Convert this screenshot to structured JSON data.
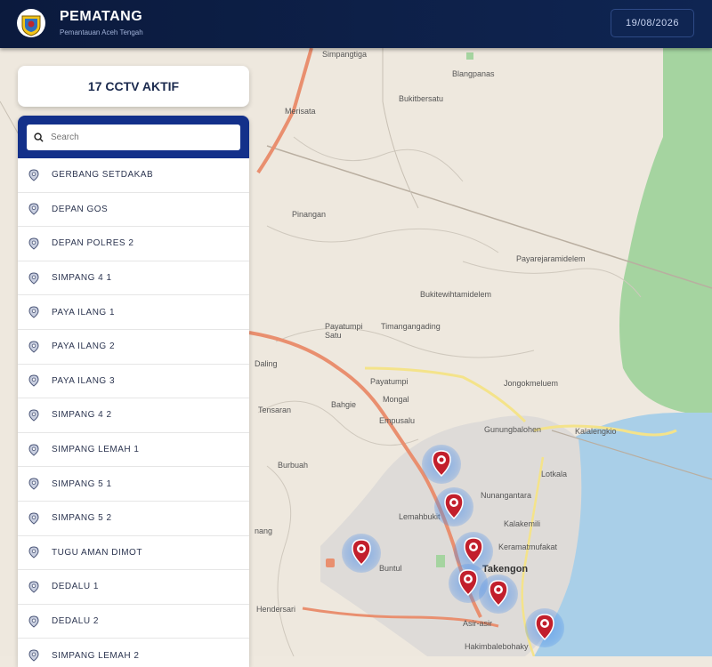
{
  "header": {
    "title": "PEMATANG",
    "subtitle": "Pemantauan Aceh Tengah",
    "date": "19/08/2026"
  },
  "summary": {
    "label": "17 CCTV AKTIF"
  },
  "search": {
    "placeholder": "Search"
  },
  "cctv_list": [
    "GERBANG SETDAKAB",
    "DEPAN GOS",
    "DEPAN POLRES 2",
    "SIMPANG 4 1",
    "PAYA ILANG 1",
    "PAYA ILANG 2",
    "PAYA ILANG 3",
    "SIMPANG 4 2",
    "SIMPANG LEMAH 1",
    "SIMPANG 5 1",
    "SIMPANG 5 2",
    "TUGU AMAN DIMOT",
    "DEDALU 1",
    "DEDALU 2",
    "SIMPANG LEMAH 2"
  ],
  "map_labels": {
    "simpangtiga": "Simpangtiga",
    "blangpanas": "Blangpanas",
    "bukitbersatu": "Bukitbersatu",
    "merisata": "Merisata",
    "pinangan": "Pinangan",
    "payarejarami": "Payarejaramidelem",
    "bukitewihtami": "Bukitewihtamidelem",
    "payatumpi_satu": "Payatumpi Satu",
    "timangangading": "Timangangading",
    "daling": "Daling",
    "payatumpi": "Payatumpi",
    "mongal": "Mongal",
    "bahgie": "Bahgie",
    "tensaran": "Tensaran",
    "jongokmeluem": "Jongokmeluem",
    "gunungbalohen": "Gunungbalohen",
    "kalalengkio": "Kalalengkio",
    "empusalu": "Empusalu",
    "lotkala": "Lotkala",
    "burbuah": "Burbuah",
    "nunangantara": "Nunangantara",
    "lemahbukit": "Lemahbukit",
    "kalakemili": "Kalakemili",
    "keramatmufakat": "Keramatmufakat",
    "takengon": "Takengon",
    "asirasir": "Asir-asir",
    "hakimbale": "Hakimbalebohaky",
    "buntul": "Buntul",
    "hendersari": "Hendersari",
    "nang": "nang"
  },
  "colors": {
    "header_bg": "#0b1a3d",
    "search_bar_bg": "#13308a",
    "marker_red": "#c21f2c",
    "marker_halo": "#4a8ce8",
    "lake": "#a9cfe8",
    "forest": "#9fd29a"
  }
}
